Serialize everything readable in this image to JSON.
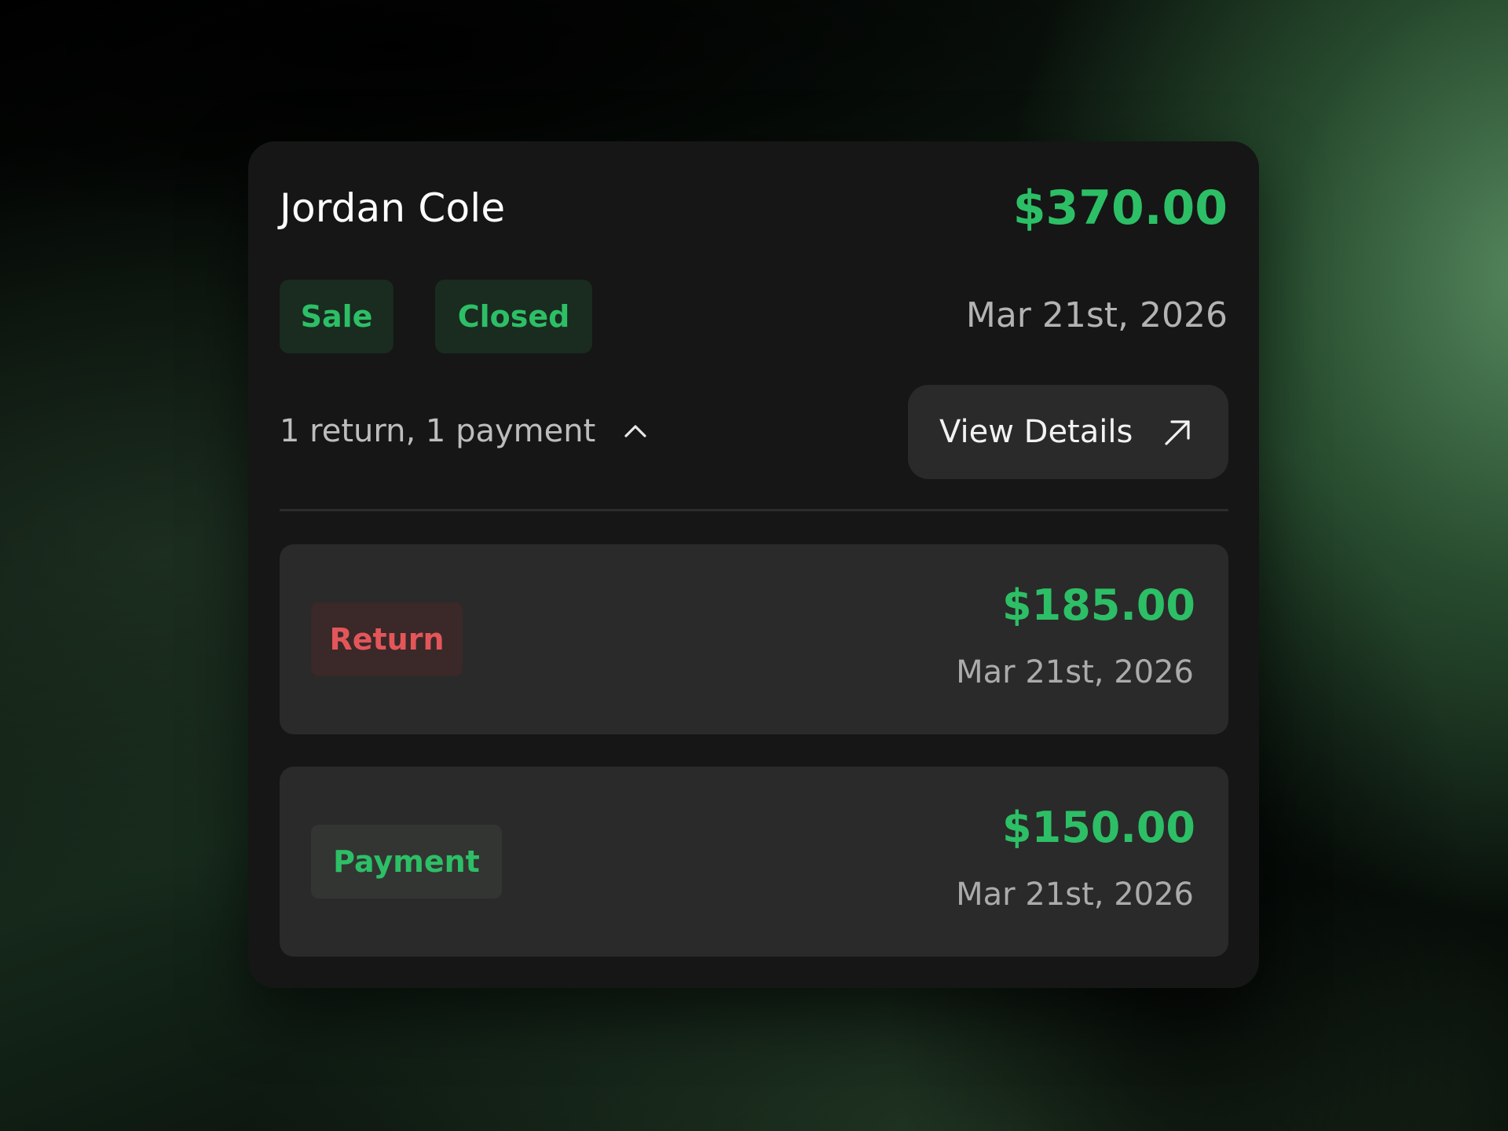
{
  "card": {
    "customer_name": "Jordan Cole",
    "total_amount": "$370.00",
    "badges": [
      {
        "label": "Sale"
      },
      {
        "label": "Closed"
      }
    ],
    "date": "Mar 21st, 2026",
    "summary": "1 return, 1 payment",
    "summary_toggle_icon": "chevron-up-icon",
    "view_details": {
      "label": "View Details",
      "icon": "arrow-up-right-icon"
    }
  },
  "transactions": [
    {
      "type": "Return",
      "amount": "$185.00",
      "date": "Mar 21st, 2026",
      "badge_color": "#e2565a"
    },
    {
      "type": "Payment",
      "amount": "$150.00",
      "date": "Mar 21st, 2026",
      "badge_color": "#2dbf66"
    }
  ],
  "colors": {
    "accent_green": "#2dbf66",
    "return_red": "#e2565a",
    "card_bg": "#161616",
    "panel_bg": "#2a2a2a"
  }
}
